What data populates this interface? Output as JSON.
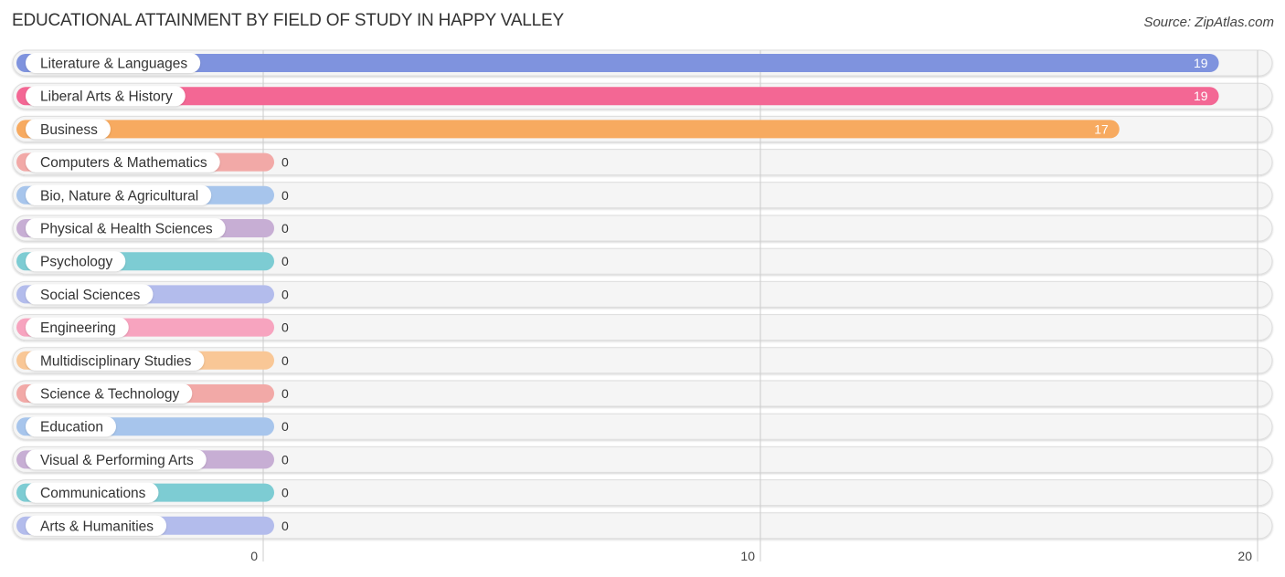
{
  "header": {
    "title": "EDUCATIONAL ATTAINMENT BY FIELD OF STUDY IN HAPPY VALLEY",
    "source": "Source: ZipAtlas.com"
  },
  "chart_data": {
    "type": "bar",
    "orientation": "horizontal",
    "title": "EDUCATIONAL ATTAINMENT BY FIELD OF STUDY IN HAPPY VALLEY",
    "xlabel": "",
    "ylabel": "",
    "xlim": [
      0,
      20
    ],
    "xticks": [
      0,
      10,
      20
    ],
    "grid": true,
    "categories": [
      "Literature & Languages",
      "Liberal Arts & History",
      "Business",
      "Computers & Mathematics",
      "Bio, Nature & Agricultural",
      "Physical & Health Sciences",
      "Psychology",
      "Social Sciences",
      "Engineering",
      "Multidisciplinary Studies",
      "Science & Technology",
      "Education",
      "Visual & Performing Arts",
      "Communications",
      "Arts & Humanities"
    ],
    "values": [
      19,
      19,
      17,
      0,
      0,
      0,
      0,
      0,
      0,
      0,
      0,
      0,
      0,
      0,
      0
    ],
    "colors": [
      "#7f93de",
      "#f36794",
      "#f7aa60",
      "#f2a9a7",
      "#a7c5ec",
      "#c7aed4",
      "#7dccd3",
      "#b3bcec",
      "#f7a4bf",
      "#f9c796",
      "#f2a9a7",
      "#a7c5ec",
      "#c7aed4",
      "#7dccd3",
      "#b3bcec"
    ]
  }
}
